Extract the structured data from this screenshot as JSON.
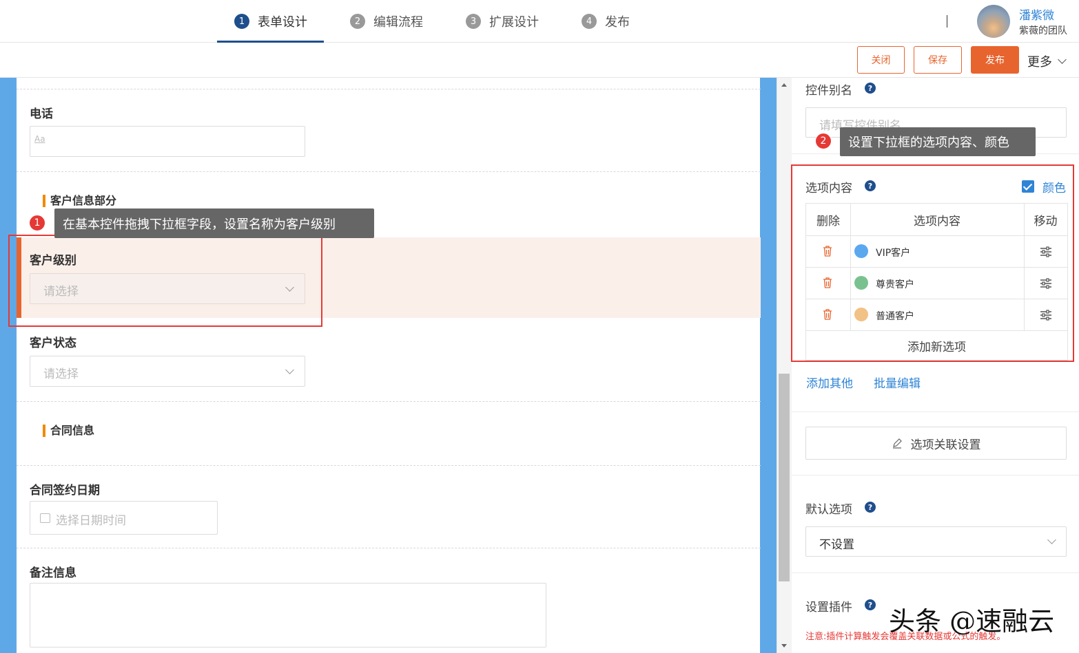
{
  "steps": [
    {
      "num": "1",
      "label": "表单设计"
    },
    {
      "num": "2",
      "label": "编辑流程"
    },
    {
      "num": "3",
      "label": "扩展设计"
    },
    {
      "num": "4",
      "label": "发布"
    }
  ],
  "user": {
    "name": "潘紫微",
    "team": "紫薇的团队"
  },
  "actions": {
    "close": "关闭",
    "save": "保存",
    "publish": "发布",
    "more": "更多"
  },
  "form": {
    "phone_label": "电话",
    "phone_placeholder": "Aa",
    "section_customer": "客户信息部分",
    "level_label": "客户级别",
    "level_placeholder": "请选择",
    "status_label": "客户状态",
    "status_placeholder": "请选择",
    "section_contract": "合同信息",
    "sign_date_label": "合同签约日期",
    "sign_date_placeholder": "选择日期时间",
    "remark_label": "备注信息"
  },
  "tips": {
    "tip1_num": "1",
    "tip1_text": "在基本控件拖拽下拉框字段，设置名称为客户级别",
    "tip2_num": "2",
    "tip2_text": "设置下拉框的选项内容、颜色"
  },
  "panel": {
    "alias_label": "控件别名",
    "alias_placeholder": "请填写控件别名",
    "options_label": "选项内容",
    "color_label": "颜色",
    "color_checked": true,
    "table_headers": [
      "删除",
      "选项内容",
      "移动"
    ],
    "options": [
      {
        "label": "VIP客户",
        "color": "#5ba8ee"
      },
      {
        "label": "尊贵客户",
        "color": "#79c28f"
      },
      {
        "label": "普通客户",
        "color": "#f2c185"
      }
    ],
    "add_option": "添加新选项",
    "add_other": "添加其他",
    "batch_edit": "批量编辑",
    "link_settings": "选项关联设置",
    "default_label": "默认选项",
    "default_value": "不设置",
    "plugin_label": "设置插件",
    "plugin_note": "注意:插件计算触发会覆盖关联数据或公式的触发。"
  },
  "watermark": "头条 @速融云",
  "colors": {
    "accent": "#e8642e",
    "primary_blue": "#1f4e8c",
    "link_blue": "#2f84d6",
    "side_strip": "#5fa8e8"
  }
}
